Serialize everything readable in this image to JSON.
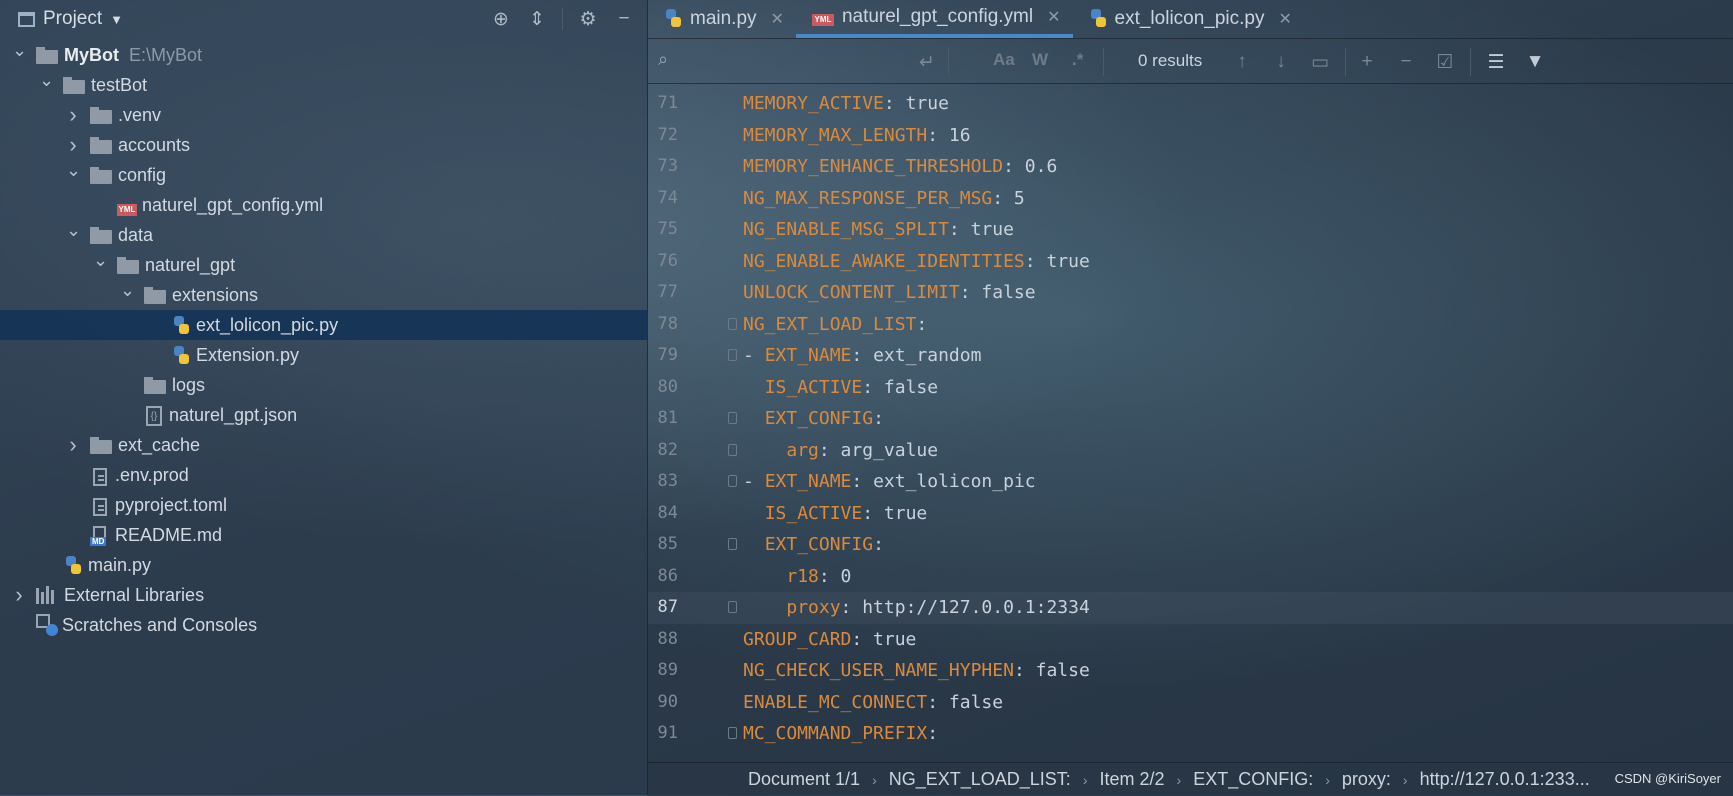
{
  "project_panel": {
    "title": "Project",
    "tree": [
      {
        "label": "MyBot",
        "path": "E:\\MyBot",
        "depth": 0,
        "kind": "folder",
        "expanded": true,
        "bold": true
      },
      {
        "label": "testBot",
        "depth": 1,
        "kind": "folder",
        "expanded": true
      },
      {
        "label": ".venv",
        "depth": 2,
        "kind": "folder",
        "expanded": false
      },
      {
        "label": "accounts",
        "depth": 2,
        "kind": "folder",
        "expanded": false
      },
      {
        "label": "config",
        "depth": 2,
        "kind": "folder",
        "expanded": true
      },
      {
        "label": "naturel_gpt_config.yml",
        "depth": 3,
        "kind": "yml"
      },
      {
        "label": "data",
        "depth": 2,
        "kind": "folder",
        "expanded": true
      },
      {
        "label": "naturel_gpt",
        "depth": 3,
        "kind": "folder",
        "expanded": true
      },
      {
        "label": "extensions",
        "depth": 4,
        "kind": "folder",
        "expanded": true
      },
      {
        "label": "ext_lolicon_pic.py",
        "depth": 5,
        "kind": "py",
        "selected": true
      },
      {
        "label": "Extension.py",
        "depth": 5,
        "kind": "py"
      },
      {
        "label": "logs",
        "depth": 4,
        "kind": "folder"
      },
      {
        "label": "naturel_gpt.json",
        "depth": 4,
        "kind": "json"
      },
      {
        "label": "ext_cache",
        "depth": 2,
        "kind": "folder",
        "expanded": false
      },
      {
        "label": ".env.prod",
        "depth": 2,
        "kind": "doc"
      },
      {
        "label": "pyproject.toml",
        "depth": 2,
        "kind": "doc"
      },
      {
        "label": "README.md",
        "depth": 2,
        "kind": "md"
      },
      {
        "label": "main.py",
        "depth": 1,
        "kind": "py"
      },
      {
        "label": "External Libraries",
        "depth": 0,
        "kind": "lib",
        "expanded": false
      },
      {
        "label": "Scratches and Consoles",
        "depth": 0,
        "kind": "scratch"
      }
    ]
  },
  "tabs": [
    {
      "label": "main.py",
      "icon": "python-icon",
      "active": false
    },
    {
      "label": "naturel_gpt_config.yml",
      "icon": "yml-icon",
      "active": true
    },
    {
      "label": "ext_lolicon_pic.py",
      "icon": "python-icon",
      "active": false
    }
  ],
  "search": {
    "value": "",
    "match_case": "Aa",
    "words": "W",
    "regex": ".*",
    "results": "0 results"
  },
  "code": {
    "current_line": 87,
    "lines": [
      {
        "n": "71",
        "key": "MEMORY_ACTIVE",
        "val": ": true",
        "indent": ""
      },
      {
        "n": "72",
        "key": "MEMORY_MAX_LENGTH",
        "val": ": 16",
        "indent": ""
      },
      {
        "n": "73",
        "key": "MEMORY_ENHANCE_THRESHOLD",
        "val": ": 0.6",
        "indent": ""
      },
      {
        "n": "74",
        "key": "NG_MAX_RESPONSE_PER_MSG",
        "val": ": 5",
        "indent": ""
      },
      {
        "n": "75",
        "key": "NG_ENABLE_MSG_SPLIT",
        "val": ": true",
        "indent": ""
      },
      {
        "n": "76",
        "key": "NG_ENABLE_AWAKE_IDENTITIES",
        "val": ": true",
        "indent": ""
      },
      {
        "n": "77",
        "key": "UNLOCK_CONTENT_LIMIT",
        "val": ": false",
        "indent": ""
      },
      {
        "n": "78",
        "key": "NG_EXT_LOAD_LIST",
        "val": ":",
        "indent": "",
        "fold": true
      },
      {
        "n": "79",
        "key": "EXT_NAME",
        "val": ": ext_random",
        "indent": "- ",
        "fold": true
      },
      {
        "n": "80",
        "key": "IS_ACTIVE",
        "val": ": false",
        "indent": "  "
      },
      {
        "n": "81",
        "key": "EXT_CONFIG",
        "val": ":",
        "indent": "  ",
        "fold": true
      },
      {
        "n": "82",
        "key": "arg",
        "val": ": arg_value",
        "indent": "    ",
        "fold": true
      },
      {
        "n": "83",
        "key": "EXT_NAME",
        "val": ": ext_lolicon_pic",
        "indent": "- ",
        "fold": true
      },
      {
        "n": "84",
        "key": "IS_ACTIVE",
        "val": ": true",
        "indent": "  "
      },
      {
        "n": "85",
        "key": "EXT_CONFIG",
        "val": ":",
        "indent": "  ",
        "fold": true
      },
      {
        "n": "86",
        "key": "r18",
        "val": ": 0",
        "indent": "    "
      },
      {
        "n": "87",
        "key": "proxy",
        "val": ": http://127.0.0.1:2334",
        "indent": "    ",
        "fold": true
      },
      {
        "n": "88",
        "key": "GROUP_CARD",
        "val": ": true",
        "indent": ""
      },
      {
        "n": "89",
        "key": "NG_CHECK_USER_NAME_HYPHEN",
        "val": ": false",
        "indent": ""
      },
      {
        "n": "90",
        "key": "ENABLE_MC_CONNECT",
        "val": ": false",
        "indent": ""
      },
      {
        "n": "91",
        "key": "MC_COMMAND_PREFIX",
        "val": ":",
        "indent": "",
        "fold": true
      }
    ]
  },
  "statusbar": {
    "crumbs": [
      "Document 1/1",
      "NG_EXT_LOAD_LIST:",
      "Item 2/2",
      "EXT_CONFIG:",
      "proxy:",
      "http://127.0.0.1:233..."
    ],
    "watermark": "CSDN @KiriSoyer"
  },
  "colors": {
    "key": "#d98a3d",
    "selection": "#12325699",
    "active_tab_underline": "#4a88c7"
  }
}
